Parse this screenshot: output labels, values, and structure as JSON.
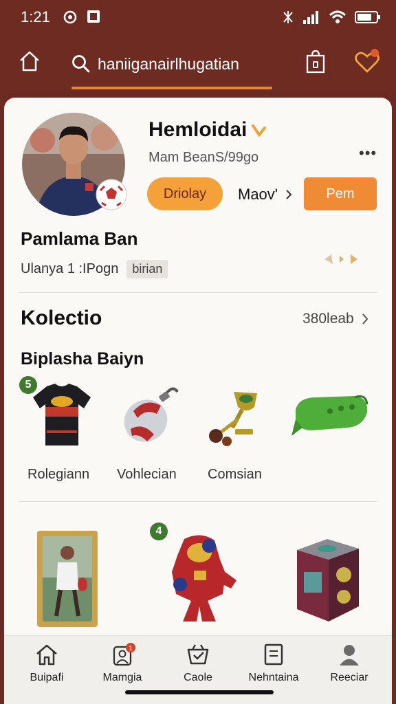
{
  "status": {
    "time": "1:21"
  },
  "search": {
    "value": "haniiganairlhugatian"
  },
  "profile": {
    "name": "Hemloidai",
    "subtitle": "Mam BeanS/99go",
    "follow_label": "Driolay",
    "more_link": "Maov'",
    "action_label": "Pem"
  },
  "info": {
    "title": "Pamlama Ban",
    "meta_text": "Ulanya 1 :IPogn",
    "tag": "birian"
  },
  "collection": {
    "title": "Kolectio",
    "count": "380leab",
    "subtitle": "Biplasha Baiyn",
    "row1": [
      {
        "label": "Rolegiann",
        "badge": "5"
      },
      {
        "label": "Vohlecian",
        "badge": ""
      },
      {
        "label": "Comsian",
        "badge": ""
      },
      {
        "label": "",
        "badge": ""
      }
    ],
    "row2_badge": "4"
  },
  "bottom_nav": [
    {
      "label": "Buipafi",
      "icon": "home-icon"
    },
    {
      "label": "Mamgia",
      "icon": "person-notification-icon",
      "badge": "1"
    },
    {
      "label": "Caole",
      "icon": "basket-icon"
    },
    {
      "label": "Nehntaina",
      "icon": "document-icon"
    },
    {
      "label": "Reeciar",
      "icon": "user-icon"
    }
  ],
  "colors": {
    "header": "#6e2b22",
    "accent": "#ef8a35",
    "follow": "#f5a13a",
    "badge_green": "#3f7a2e"
  }
}
